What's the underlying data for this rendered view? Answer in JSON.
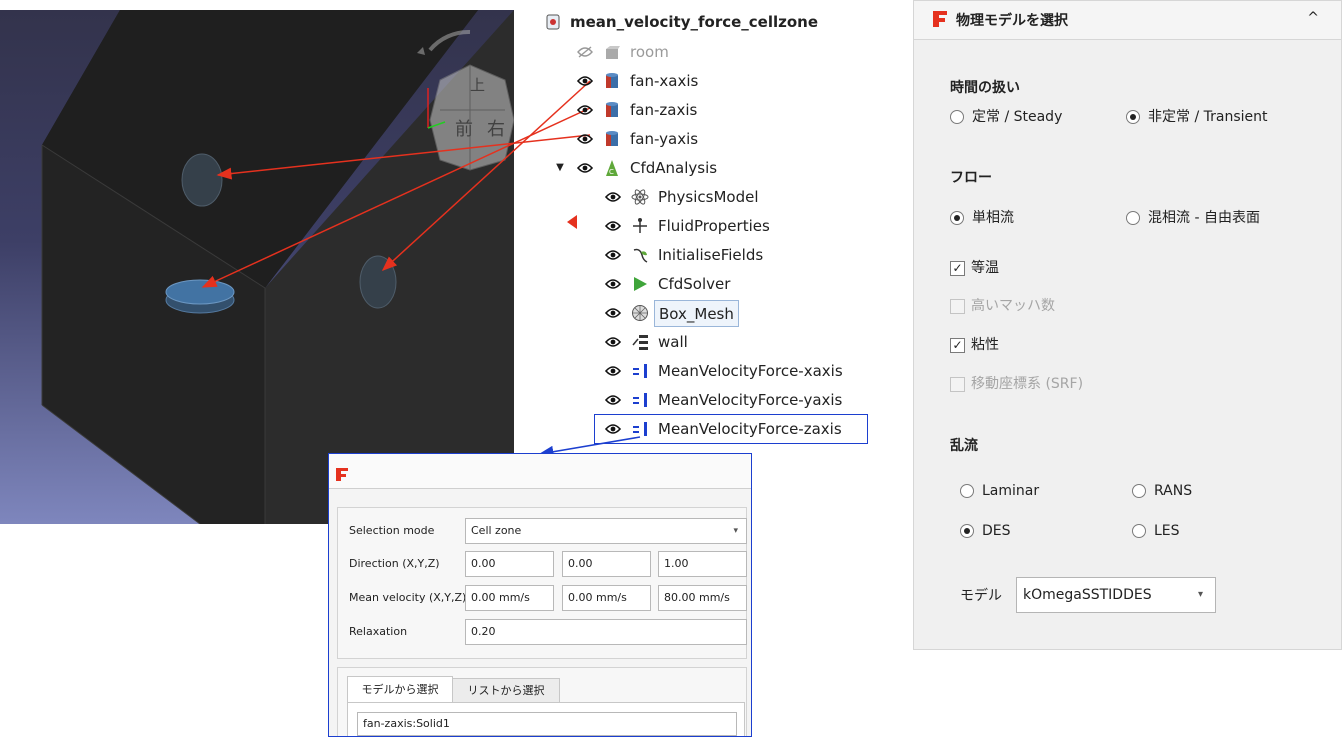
{
  "tree": {
    "root": "mean_velocity_force_cellzone",
    "items": [
      {
        "label": "room",
        "icon": "part-icon",
        "visible": false
      },
      {
        "label": "fan-xaxis",
        "icon": "cylinder-icon",
        "visible": true
      },
      {
        "label": "fan-zaxis",
        "icon": "cylinder-icon",
        "visible": true
      },
      {
        "label": "fan-yaxis",
        "icon": "cylinder-icon",
        "visible": true
      },
      {
        "label": "CfdAnalysis",
        "icon": "analysis-icon",
        "visible": true
      },
      {
        "label": "PhysicsModel",
        "icon": "atom-icon",
        "visible": true
      },
      {
        "label": "FluidProperties",
        "icon": "fluid-icon",
        "visible": true
      },
      {
        "label": "InitialiseFields",
        "icon": "initialise-icon",
        "visible": true
      },
      {
        "label": "CfdSolver",
        "icon": "play-icon",
        "visible": true
      },
      {
        "label": "Box_Mesh",
        "icon": "mesh-icon",
        "visible": true
      },
      {
        "label": "wall",
        "icon": "boundary-icon",
        "visible": true
      },
      {
        "label": "MeanVelocityForce-xaxis",
        "icon": "force-icon",
        "visible": true
      },
      {
        "label": "MeanVelocityForce-yaxis",
        "icon": "force-icon",
        "visible": true
      },
      {
        "label": "MeanVelocityForce-zaxis",
        "icon": "force-icon",
        "visible": true
      }
    ]
  },
  "task": {
    "selection_mode_label": "Selection mode",
    "selection_mode_value": "Cell zone",
    "direction_label": "Direction (X,Y,Z)",
    "direction": [
      "0.00",
      "0.00",
      "1.00"
    ],
    "velocity_label": "Mean velocity (X,Y,Z)",
    "velocity": [
      "0.00 mm/s",
      "0.00 mm/s",
      "80.00 mm/s"
    ],
    "relaxation_label": "Relaxation",
    "relaxation": "0.20",
    "tab_model": "モデルから選択",
    "tab_list": "リストから選択",
    "selected_item": "fan-zaxis:Solid1"
  },
  "physics": {
    "title": "物理モデルを選択",
    "collapse_icon": "^",
    "time_title": "時間の扱い",
    "steady": "定常 / Steady",
    "transient": "非定常 / Transient",
    "flow_title": "フロー",
    "single_phase": "単相流",
    "multiphase": "混相流 - 自由表面",
    "isothermal": "等温",
    "high_mach": "高いマッハ数",
    "viscous": "粘性",
    "srf": "移動座標系 (SRF)",
    "turb_title": "乱流",
    "laminar": "Laminar",
    "rans": "RANS",
    "des": "DES",
    "les": "LES",
    "model_label": "モデル",
    "model_value": "kOmegaSSTIDDES"
  },
  "viewcube": {
    "front": "前",
    "right": "右",
    "top": "上"
  },
  "colors": {
    "accent": "#1c3fcf",
    "arrow": "#e5311e",
    "viewport_top": "#33334c",
    "viewport_bottom": "#7e86bd"
  }
}
